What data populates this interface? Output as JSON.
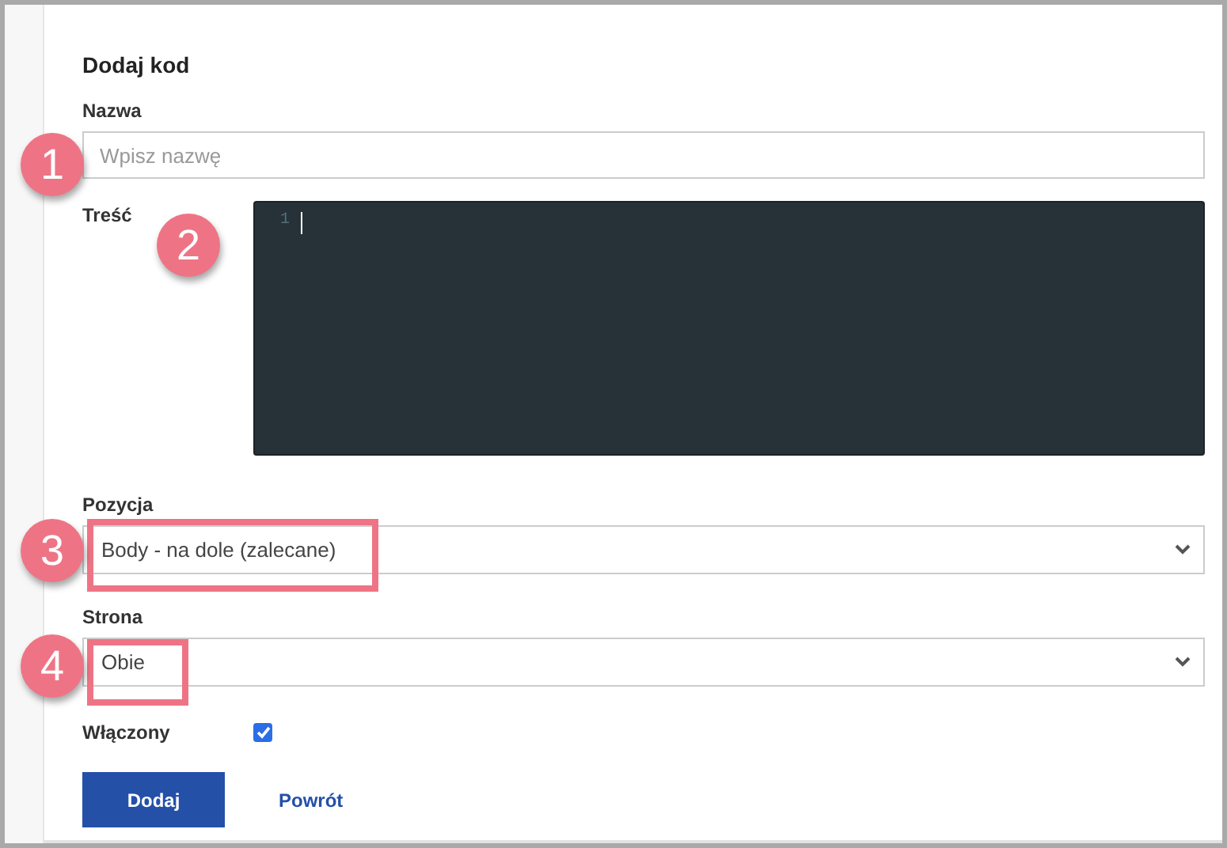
{
  "title": "Dodaj kod",
  "name_field": {
    "label": "Nazwa",
    "placeholder": "Wpisz nazwę"
  },
  "content_field": {
    "label": "Treść",
    "line_numbers": [
      "1"
    ]
  },
  "position_field": {
    "label": "Pozycja",
    "value": "Body - na dole (zalecane)"
  },
  "page_field": {
    "label": "Strona",
    "value": "Obie"
  },
  "enabled": {
    "label": "Włączony",
    "checked": true
  },
  "buttons": [
    {
      "label": "Dodaj",
      "kind": "primary"
    },
    {
      "label": "Powrót",
      "kind": "link"
    }
  ],
  "callouts": [
    {
      "number": "1"
    },
    {
      "number": "2"
    },
    {
      "number": "3",
      "highlight": true
    },
    {
      "number": "4",
      "highlight": true
    }
  ]
}
